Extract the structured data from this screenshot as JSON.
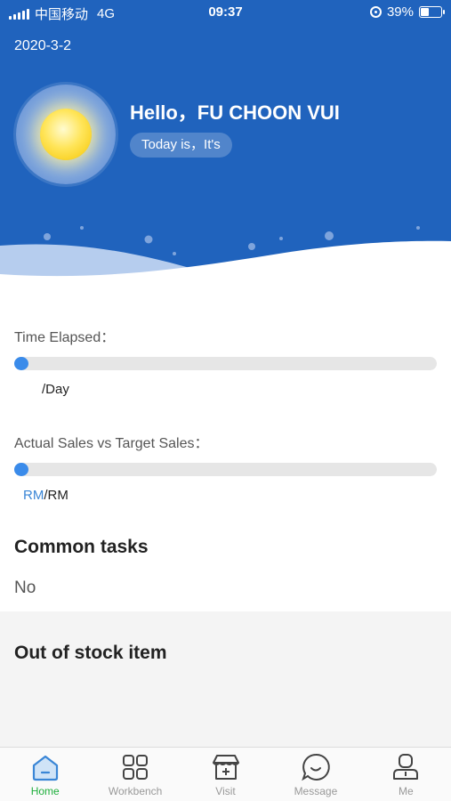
{
  "status_bar": {
    "carrier": "中国移动",
    "network": "4G",
    "time": "09:37",
    "battery": "39%",
    "battery_level": 0.39
  },
  "header": {
    "date": "2020-3-2",
    "greeting": "Hello，FU CHOON VUI",
    "today_text": "Today is，It's"
  },
  "time_elapsed": {
    "label": "Time Elapsed：",
    "progress": 0,
    "value_suffix": "/Day"
  },
  "sales": {
    "label": "Actual Sales vs Target Sales：",
    "progress": 0,
    "actual_prefix": "RM",
    "target_suffix": "/RM"
  },
  "common_tasks": {
    "title": "Common tasks",
    "empty_text": "No"
  },
  "out_of_stock": {
    "title": "Out of stock item"
  },
  "tabbar": {
    "items": [
      {
        "label": "Home",
        "icon": "home-icon",
        "active": true
      },
      {
        "label": "Workbench",
        "icon": "grid-icon",
        "active": false
      },
      {
        "label": "Visit",
        "icon": "store-icon",
        "active": false
      },
      {
        "label": "Message",
        "icon": "chat-icon",
        "active": false
      },
      {
        "label": "Me",
        "icon": "user-icon",
        "active": false
      }
    ]
  },
  "colors": {
    "header_blue": "#2063bd",
    "accent_blue": "#3a8bea",
    "active_green": "#1dae3b"
  }
}
